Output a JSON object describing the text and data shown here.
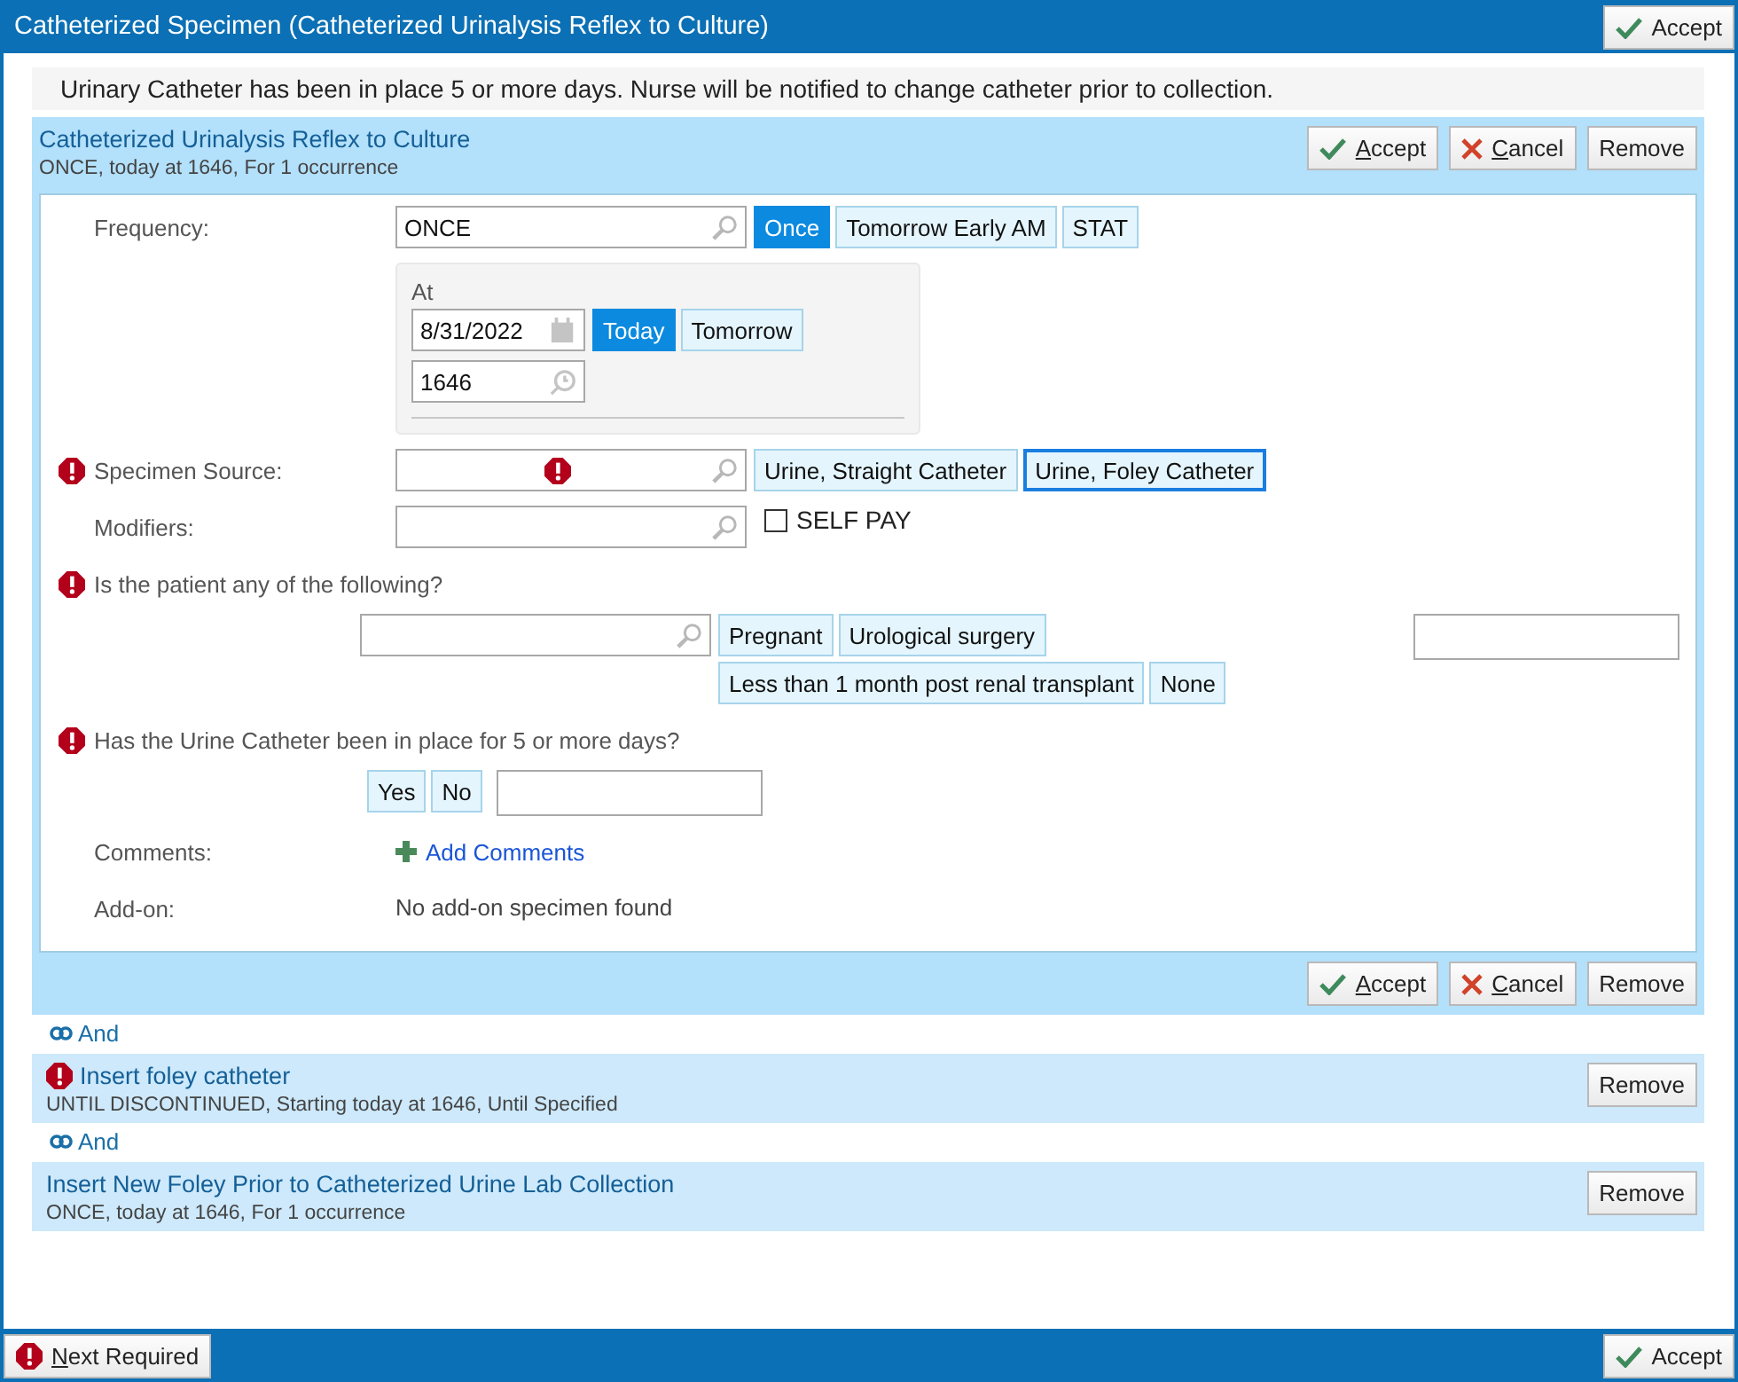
{
  "window": {
    "title": "Catheterized Specimen (Catheterized Urinalysis Reflex to Culture)",
    "button": {
      "kind": "accept",
      "label": "Accept",
      "mnemonic": false
    }
  },
  "notice": "Urinary Catheter has been in place 5 or more days. Nurse will be notified to change catheter prior to collection.",
  "orders": [
    {
      "title": "Catheterized Urinalysis Reflex to Culture",
      "subtitle": "ONCE, today at 1646, For 1 occurrence",
      "required": false,
      "expanded": true,
      "buttons": [
        {
          "kind": "accept",
          "label": "Accept",
          "mnemonic": true
        },
        {
          "kind": "cancel",
          "label": "Cancel",
          "mnemonic": true
        },
        {
          "kind": "remove",
          "label": "Remove",
          "mnemonic": false
        }
      ],
      "form": [
        {
          "kind": "lookup",
          "label": "Frequency:",
          "required": false,
          "value": "ONCE",
          "field_error": false,
          "options": [
            {
              "label": "Once",
              "selected": true,
              "focused": false
            },
            {
              "label": "Tomorrow Early AM",
              "selected": false,
              "focused": false
            },
            {
              "label": "STAT",
              "selected": false,
              "focused": false
            }
          ]
        },
        {
          "kind": "datetime",
          "label": "At",
          "date": "8/31/2022",
          "date_options": [
            {
              "label": "Today",
              "selected": true,
              "focused": false
            },
            {
              "label": "Tomorrow",
              "selected": false,
              "focused": false
            }
          ],
          "time": "1646"
        },
        {
          "kind": "lookup",
          "label": "Specimen Source:",
          "required": true,
          "field_error": true,
          "options": [
            {
              "label": "Urine, Straight Catheter",
              "selected": false,
              "focused": false
            },
            {
              "label": "Urine, Foley Catheter",
              "selected": false,
              "focused": true
            }
          ]
        },
        {
          "kind": "checkbox",
          "label": "Modifiers:",
          "required": false,
          "field_error": false,
          "checkbox": {
            "label": "SELF PAY",
            "checked": false
          }
        },
        {
          "kind": "question_lookup",
          "label": "Is the patient any of the following?",
          "required": true,
          "options": [
            {
              "label": "Pregnant",
              "selected": false,
              "focused": false
            },
            {
              "label": "Urological surgery",
              "selected": false,
              "focused": false
            },
            {
              "label": "Less than 1 month post renal transplant",
              "selected": false,
              "focused": false
            },
            {
              "label": "None",
              "selected": false,
              "focused": false
            }
          ]
        },
        {
          "kind": "question",
          "label": "Has the Urine Catheter been in place for 5 or more days?",
          "required": true,
          "options": [
            {
              "label": "Yes",
              "selected": false,
              "focused": false
            },
            {
              "label": "No",
              "selected": false,
              "focused": false
            }
          ]
        },
        {
          "kind": "link",
          "label": "Comments:",
          "required": false,
          "link": "Add Comments"
        },
        {
          "kind": "text",
          "label": "Add-on:",
          "required": false,
          "text": "No add-on specimen found"
        }
      ],
      "footer_buttons": [
        {
          "kind": "accept",
          "label": "Accept",
          "mnemonic": true
        },
        {
          "kind": "cancel",
          "label": "Cancel",
          "mnemonic": true
        },
        {
          "kind": "remove",
          "label": "Remove",
          "mnemonic": false
        }
      ]
    },
    {
      "connector": "And",
      "title": "Insert foley catheter",
      "subtitle": "UNTIL DISCONTINUED, Starting today at 1646, Until Specified",
      "required": true,
      "expanded": false,
      "buttons": [
        {
          "kind": "remove",
          "label": "Remove",
          "mnemonic": false
        }
      ]
    },
    {
      "connector": "And",
      "title": "Insert New Foley Prior to Catheterized Urine Lab Collection",
      "subtitle": "ONCE, today at 1646, For 1 occurrence",
      "required": false,
      "expanded": false,
      "buttons": [
        {
          "kind": "remove",
          "label": "Remove",
          "mnemonic": false
        }
      ]
    }
  ],
  "footer": {
    "left": {
      "kind": "next",
      "label": "Next Required",
      "mnemonic": true
    },
    "right": {
      "kind": "accept",
      "label": "Accept",
      "mnemonic": false
    }
  }
}
